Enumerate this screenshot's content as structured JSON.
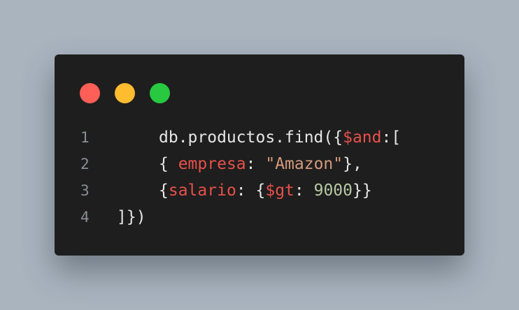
{
  "window": {
    "controls": [
      {
        "name": "close-dot",
        "color": "#ff5f57"
      },
      {
        "name": "minimize-dot",
        "color": "#febc2e"
      },
      {
        "name": "maximize-dot",
        "color": "#28c840"
      }
    ]
  },
  "code": {
    "lines": [
      {
        "number": "1",
        "tokens": [
          {
            "text": "db.productos.find({",
            "kind": "punc"
          },
          {
            "text": "$and",
            "kind": "key"
          },
          {
            "text": ":[",
            "kind": "punc"
          }
        ]
      },
      {
        "number": "2",
        "tokens": [
          {
            "text": "{ ",
            "kind": "punc"
          },
          {
            "text": "empresa",
            "kind": "key"
          },
          {
            "text": ": ",
            "kind": "punc"
          },
          {
            "text": "\"Amazon\"",
            "kind": "str"
          },
          {
            "text": "},",
            "kind": "punc"
          }
        ]
      },
      {
        "number": "3",
        "tokens": [
          {
            "text": "{",
            "kind": "punc"
          },
          {
            "text": "salario",
            "kind": "key"
          },
          {
            "text": ": {",
            "kind": "punc"
          },
          {
            "text": "$gt",
            "kind": "key"
          },
          {
            "text": ": ",
            "kind": "punc"
          },
          {
            "text": "9000",
            "kind": "num"
          },
          {
            "text": "}}",
            "kind": "punc"
          }
        ]
      },
      {
        "number": "4",
        "tokens": [
          {
            "text": "]})",
            "kind": "punc"
          }
        ]
      }
    ]
  }
}
